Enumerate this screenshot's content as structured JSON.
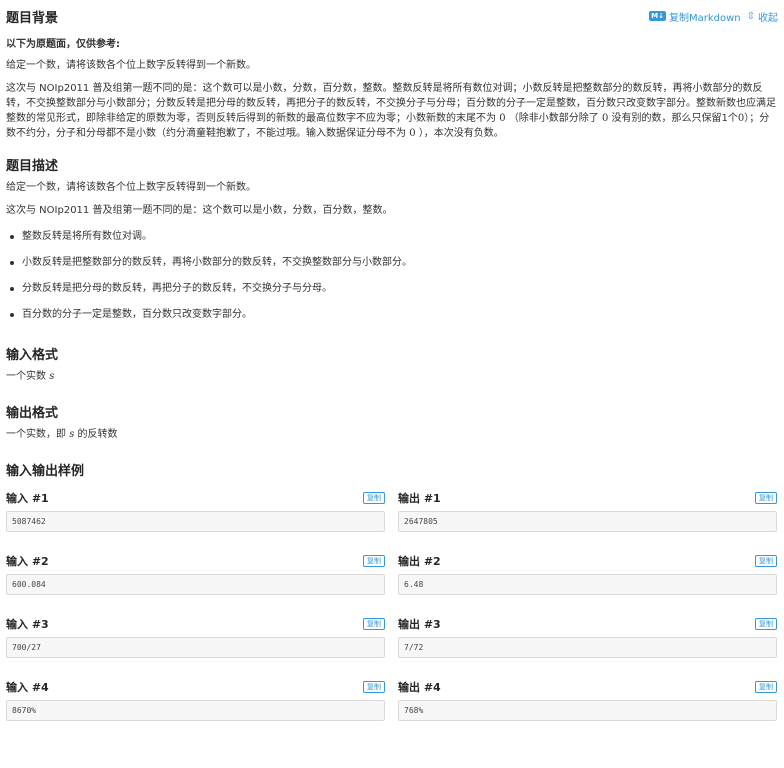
{
  "background": {
    "title": "题目背景",
    "note": "以下为原题面，仅供参考:",
    "intro": "给定一个数，请将该数各个位上数字反转得到一个新数。",
    "detail_line1": "这次与 NOIp2011 普及组第一题不同的是：这个数可以是小数，分数，百分数，整数。整数反转是将所有数位对调；小数反转是把整数部分的数反转，再将小数部分",
    "detail_line2": "的数反转，不交换整数部分与小数部分；分数反转是把分母的数反转，再把分子的数反转，不交换分子与分母；百分数的分子一定是整数，百分数只改变数字部分。",
    "detail_line3a": "整数新数也应满足整数的常见形式，即除非给定的原数为零，否则反转后得到的新数的最高位数字不应为零；小数新数的末尾不为",
    "detail_line3b": "（除非小数部分除了",
    "detail_line3c": "没有别的",
    "detail_line4a": "数，那么只保留1个",
    "detail_line4b": "）；分数不约分，分子和分母都不是小数（约分滴童鞋抱歉了，不能过哦。输入数据保证分母不为",
    "detail_line4c": "），本次没有负数。",
    "zero": "0"
  },
  "toolbar": {
    "md_icon": "M↓",
    "copy_markdown": "复制Markdown",
    "collapse_icon": "⇳",
    "collapse": "收起"
  },
  "description": {
    "title": "题目描述",
    "intro": "给定一个数，请将该数各个位上数字反转得到一个新数。",
    "detail": "这次与 NOIp2011 普及组第一题不同的是：这个数可以是小数，分数，百分数，整数。",
    "bullets": [
      "整数反转是将所有数位对调。",
      "小数反转是把整数部分的数反转，再将小数部分的数反转，不交换整数部分与小数部分。",
      "分数反转是把分母的数反转，再把分子的数反转，不交换分子与分母。",
      "百分数的分子一定是整数，百分数只改变数字部分。"
    ]
  },
  "input_format": {
    "title": "输入格式",
    "text": "一个实数",
    "var": "s"
  },
  "output_format": {
    "title": "输出格式",
    "text_a": "一个实数，即",
    "var": "s",
    "text_b": "的反转数"
  },
  "samples": {
    "title": "输入输出样例",
    "copy_label": "复制",
    "items": [
      {
        "in_label": "输入 #1",
        "in": "5087462",
        "out_label": "输出 #1",
        "out": "2647805"
      },
      {
        "in_label": "输入 #2",
        "in": "600.084",
        "out_label": "输出 #2",
        "out": "6.48"
      },
      {
        "in_label": "输入 #3",
        "in": "700/27",
        "out_label": "输出 #3",
        "out": "7/72"
      },
      {
        "in_label": "输入 #4",
        "in": "8670%",
        "out_label": "输出 #4",
        "out": "768%"
      }
    ]
  }
}
